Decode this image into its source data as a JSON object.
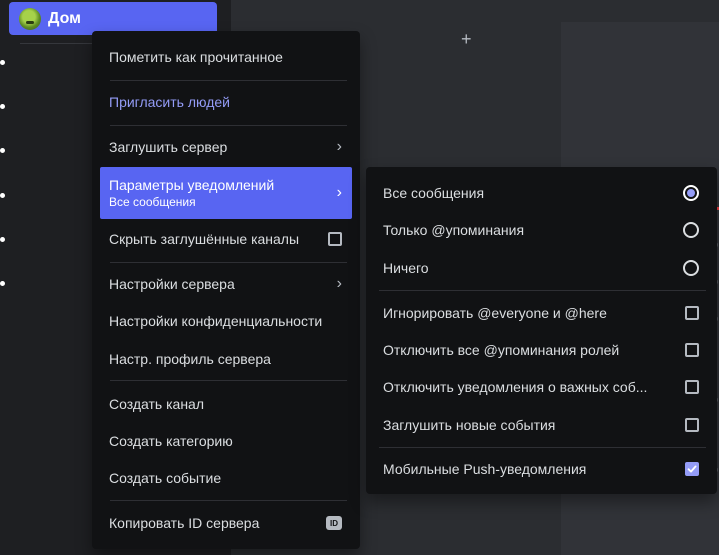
{
  "app": {
    "guild_name": "Дом",
    "plus_glyph": "+",
    "edge_glyphs": [
      "д",
      "д",
      "д",
      "д",
      "д"
    ]
  },
  "colors": {
    "accent": "#5865f2",
    "accent_text": "#949cf7",
    "menu_bg": "#111214"
  },
  "server_menu": {
    "mark_read": "Пометить как прочитанное",
    "invite": "Пригласить людей",
    "mute_server": "Заглушить сервер",
    "notification_settings": "Параметры уведомлений",
    "notification_settings_value": "Все сообщения",
    "hide_muted": "Скрыть заглушённые каналы",
    "server_settings": "Настройки сервера",
    "privacy_settings": "Настройки конфиденциальности",
    "edit_profile": "Настр. профиль сервера",
    "create_channel": "Создать канал",
    "create_category": "Создать категорию",
    "create_event": "Создать событие",
    "copy_id": "Копировать ID сервера",
    "id_badge": "ID"
  },
  "notification_menu": {
    "options": [
      {
        "label": "Все сообщения",
        "selected": true
      },
      {
        "label": "Только @упоминания",
        "selected": false
      },
      {
        "label": "Ничего",
        "selected": false
      }
    ],
    "toggles": [
      {
        "label": "Игнорировать @everyone и @here",
        "checked": false
      },
      {
        "label": "Отключить все @упоминания ролей",
        "checked": false
      },
      {
        "label": "Отключить уведомления о важных соб...",
        "checked": false
      },
      {
        "label": "Заглушить новые события",
        "checked": false
      }
    ],
    "mobile_push": {
      "label": "Мобильные Push-уведомления",
      "checked": true
    }
  }
}
